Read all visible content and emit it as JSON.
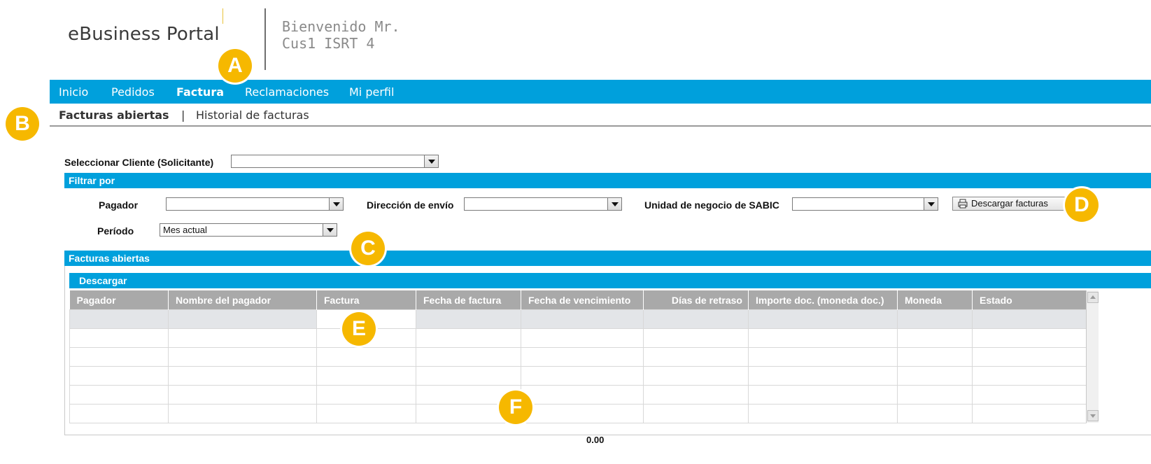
{
  "header": {
    "logo": "eBusiness Portal",
    "welcome_line1": "Bienvenido Mr.",
    "welcome_line2": "Cus1 ISRT 4"
  },
  "topnav": {
    "items": [
      "Inicio",
      "Pedidos",
      "Factura",
      "Reclamaciones",
      "Mi perfil"
    ],
    "active": "Factura"
  },
  "subnav": {
    "items": [
      "Facturas abiertas",
      "Historial de facturas"
    ],
    "separator": "|",
    "active": "Facturas abiertas"
  },
  "client": {
    "label": "Seleccionar Cliente (Solicitante)",
    "value": ""
  },
  "filter": {
    "title": "Filtrar por",
    "payer_label": "Pagador",
    "payer_value": "",
    "ship_label": "Dirección de envío",
    "ship_value": "",
    "bu_label": "Unidad de negocio de SABIC",
    "bu_value": "",
    "period_label": "Período",
    "period_value": "Mes actual",
    "download_invoices": "Descargar facturas"
  },
  "open_invoices": {
    "title": "Facturas abiertas",
    "download_bar": "Descargar",
    "columns": [
      "Pagador",
      "Nombre del pagador",
      "Factura",
      "Fecha de factura",
      "Fecha de vencimiento",
      "Días de retraso",
      "Importe doc. (moneda doc.)",
      "Moneda",
      "Estado"
    ],
    "rows": [],
    "total": "0.00"
  },
  "annotations": [
    "A",
    "B",
    "C",
    "D",
    "E",
    "F"
  ],
  "colors": {
    "nav": "#00a0dc",
    "badge": "#f6b800",
    "header_grid": "#a9a9a9"
  }
}
